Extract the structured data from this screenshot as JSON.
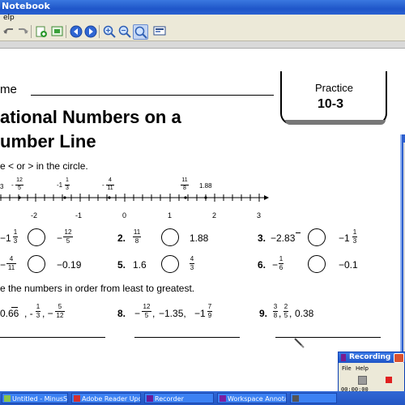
{
  "window": {
    "title": "Notebook",
    "menu_help": "elp"
  },
  "toolbar": {
    "buttons": [
      "undo-icon",
      "redo-icon",
      "add-page-icon",
      "add-slide-icon",
      "back-icon",
      "forward-icon",
      "zoom-in-icon",
      "zoom-out-icon",
      "zoom-fit-icon",
      "screen-icon"
    ]
  },
  "worksheet": {
    "name_label": "me",
    "practice_label": "Practice",
    "practice_number": "10-3",
    "title_line1": "ational Numbers on a",
    "title_line2": "umber Line",
    "instruction1": "e < or > in the circle.",
    "numberline": {
      "ticks": [
        "-2",
        "-1",
        "0",
        "1",
        "2",
        "3"
      ],
      "points": [
        {
          "label": "-1",
          "num": "1",
          "den": "3"
        },
        {
          "label": "-",
          "num": "12",
          "den": "5"
        },
        {
          "label": "-",
          "num": "4",
          "den": "11"
        },
        {
          "label": "",
          "num": "11",
          "den": "8"
        },
        {
          "label": "1.88",
          "num": "",
          "den": ""
        }
      ],
      "left_cut": "3"
    },
    "row1": {
      "p1_left_pre": "−1",
      "p1_left_num": "1",
      "p1_left_den": "3",
      "p1_right_pre": "−",
      "p1_right_num": "12",
      "p1_right_den": "5",
      "p2_num": "2.",
      "p2_left_num": "11",
      "p2_left_den": "8",
      "p2_right": "1.88",
      "p3_num": "3.",
      "p3_left": "−2.83",
      "p3_right_pre": "−1",
      "p3_right_num": "1",
      "p3_right_den": "3"
    },
    "row2": {
      "p1_left_pre": "−",
      "p1_left_num": "4",
      "p1_left_den": "11",
      "p1_right": "−0.19",
      "p5_num": "5.",
      "p5_left": "1.6",
      "p5_right_num": "4",
      "p5_right_den": "3",
      "p6_num": "6.",
      "p6_left_pre": "−",
      "p6_left_num": "1",
      "p6_left_den": "6",
      "p6_right": "−0.1"
    },
    "instruction2": "e the numbers in order from least to greatest.",
    "row3": {
      "p7_a": "0.66",
      "p7_b_num": "1",
      "p7_b_den": "3",
      "p7_c_num": "5",
      "p7_c_den": "12",
      "p8_num": "8.",
      "p8_a_num": "12",
      "p8_a_den": "5",
      "p8_b": "−1.35,",
      "p8_c_pre": "−1",
      "p8_c_num": "7",
      "p8_c_den": "9",
      "p9_num": "9.",
      "p9_a_num": "3",
      "p9_a_den": "8",
      "p9_b_num": "2",
      "p9_b_den": "5",
      "p9_c": "0.38"
    }
  },
  "recording": {
    "title": "Recording",
    "menu_file": "File",
    "menu_help": "Help",
    "timer": "00:00:00"
  },
  "taskbar": {
    "tasks": [
      "Untitled - MinusStudio...",
      "Adobe Reader Updater",
      "Recorder",
      "Workspace Annotatio..."
    ]
  }
}
